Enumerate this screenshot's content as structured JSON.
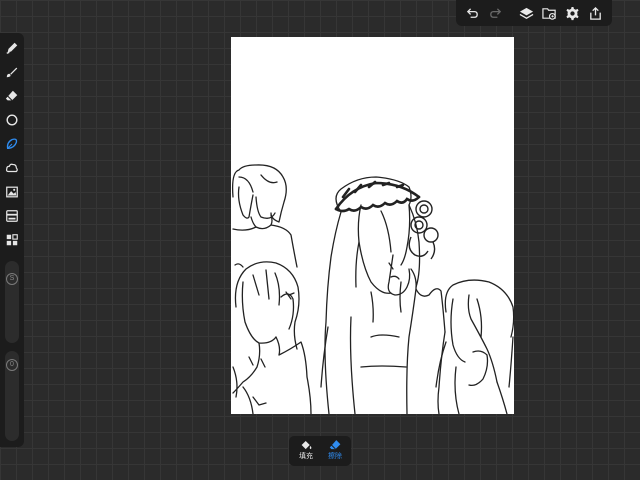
{
  "top_toolbar": {
    "undo_icon": "undo-icon",
    "redo_icon": "redo-icon",
    "layers_icon": "layers-icon",
    "import_icon": "folder-import-icon",
    "settings_icon": "gear-icon",
    "share_icon": "share-icon"
  },
  "left_toolbar": {
    "tools": [
      "pen-icon",
      "brush-icon",
      "eraser-icon",
      "circle-icon",
      "lasso-icon",
      "cloud-select-icon",
      "image-icon",
      "layout-icon",
      "grid-icon"
    ],
    "active_tool": "lasso-icon",
    "size_value": "S",
    "opacity_value": "0"
  },
  "bottom_bar": {
    "fill_label": "填充",
    "erase_label": "擦除"
  },
  "colors": {
    "accent": "#2f8cf0",
    "panel": "#1c1c1c",
    "background": "#2b2b2b"
  }
}
